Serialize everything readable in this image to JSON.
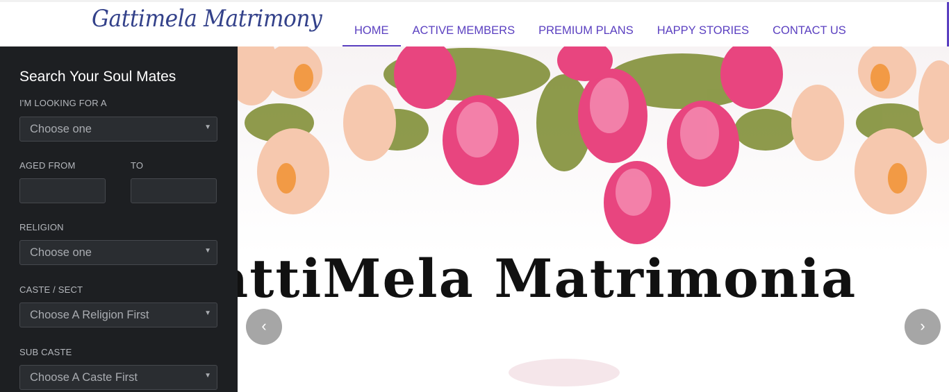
{
  "header": {
    "logo_text": "Gattimela Matrimony",
    "nav": [
      "HOME",
      "ACTIVE MEMBERS",
      "PREMIUM PLANS",
      "HAPPY STORIES",
      "CONTACT US"
    ],
    "active_nav": "HOME",
    "accent_color": "#5a3fc0"
  },
  "sidebar": {
    "title": "Search Your Soul Mates",
    "looking_for_label": "I'M LOOKING FOR A",
    "looking_for_value": "Choose one",
    "aged_from_label": "AGED FROM",
    "to_label": "TO",
    "aged_from_value": "",
    "to_value": "",
    "religion_label": "RELIGION",
    "religion_value": "Choose one",
    "caste_label": "CASTE / SECT",
    "caste_value": "Choose A Religion First",
    "subcaste_label": "SUB CASTE",
    "subcaste_value": "Choose A Caste First"
  },
  "hero": {
    "banner_text": "attiMela Matrimonia",
    "prev_icon": "chevron-left-icon",
    "next_icon": "chevron-right-icon",
    "prev_glyph": "‹",
    "next_glyph": "›"
  }
}
